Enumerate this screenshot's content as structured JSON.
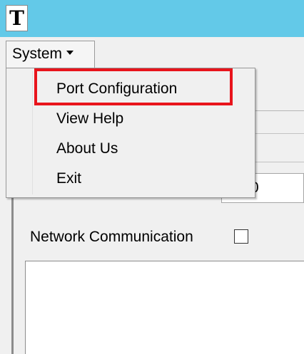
{
  "titlebar": {
    "icon_glyph": "T",
    "color": "#63c9e8"
  },
  "menubar": {
    "system_label": "System"
  },
  "dropdown": {
    "items": [
      {
        "label": "Port Configuration"
      },
      {
        "label": "View Help"
      },
      {
        "label": "About Us"
      },
      {
        "label": "Exit"
      }
    ]
  },
  "content": {
    "port_input_value": "0",
    "network_label": "Network Communication",
    "network_checked": false
  },
  "highlight": {
    "target": "Port Configuration",
    "color": "#e8141c"
  }
}
